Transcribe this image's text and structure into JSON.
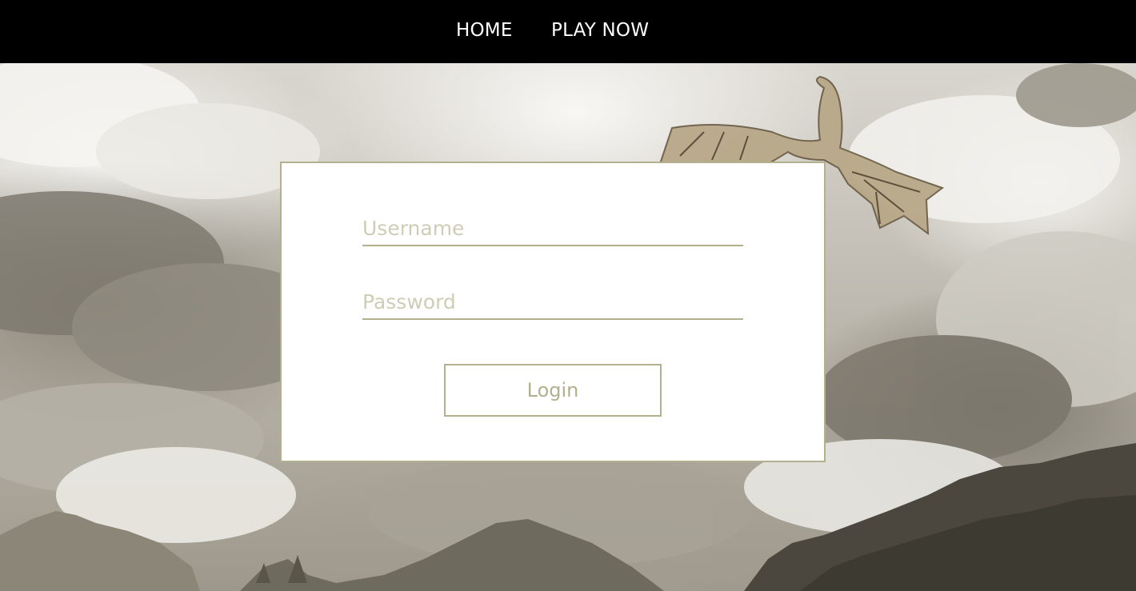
{
  "nav": {
    "home_label": "HOME",
    "play_label": "PLAY NOW"
  },
  "login": {
    "username_placeholder": "Username",
    "password_placeholder": "Password",
    "button_label": "Login"
  },
  "colors": {
    "nav_bg": "#000000",
    "nav_text": "#ffffff",
    "accent": "#b3b08e",
    "placeholder": "#cfcdb5",
    "card_bg": "#ffffff"
  },
  "icons": [
    "dragon-illustration",
    "mountain-silhouette"
  ]
}
